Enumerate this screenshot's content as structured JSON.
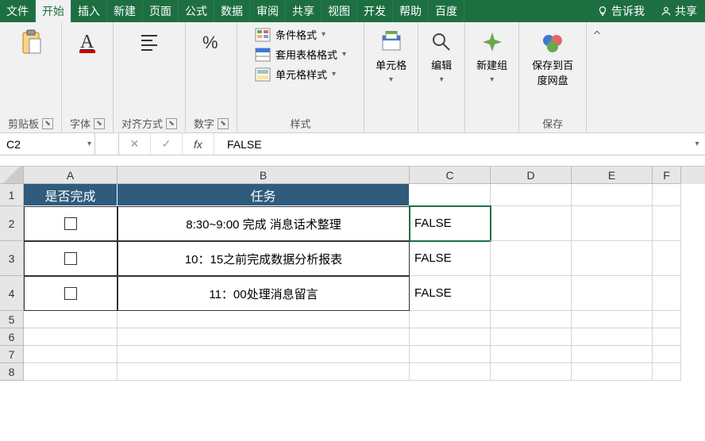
{
  "menu": {
    "tabs": [
      "文件",
      "开始",
      "插入",
      "新建",
      "页面",
      "公式",
      "数据",
      "审阅",
      "共享",
      "视图",
      "开发",
      "帮助",
      "百度"
    ],
    "active_index": 1,
    "tell_me": "告诉我",
    "share": "共享"
  },
  "ribbon": {
    "clipboard": {
      "label": "剪贴板"
    },
    "font": {
      "label": "字体"
    },
    "alignment": {
      "label": "对齐方式"
    },
    "number": {
      "label": "数字"
    },
    "styles": {
      "label": "样式",
      "conditional": "条件格式",
      "table": "套用表格格式",
      "cell": "单元格样式"
    },
    "cells": {
      "label": "单元格"
    },
    "editing": {
      "label": "编辑"
    },
    "newgroup": {
      "label": "新建组"
    },
    "save": {
      "btn": "保存到百度网盘",
      "label": "保存"
    }
  },
  "formula_bar": {
    "name_box": "C2",
    "value": "FALSE"
  },
  "sheet": {
    "columns": [
      "A",
      "B",
      "C",
      "D",
      "E",
      "F"
    ],
    "row_numbers": [
      "1",
      "2",
      "3",
      "4",
      "5",
      "6",
      "7",
      "8"
    ],
    "header": {
      "col_a": "是否完成",
      "col_b": "任务"
    },
    "rows": [
      {
        "checked": false,
        "task": "8:30~9:00 完成 消息话术整理",
        "c": "FALSE"
      },
      {
        "checked": false,
        "task": "10：15之前完成数据分析报表",
        "c": "FALSE"
      },
      {
        "checked": false,
        "task": "11：00处理消息留言",
        "c": "FALSE"
      }
    ]
  }
}
